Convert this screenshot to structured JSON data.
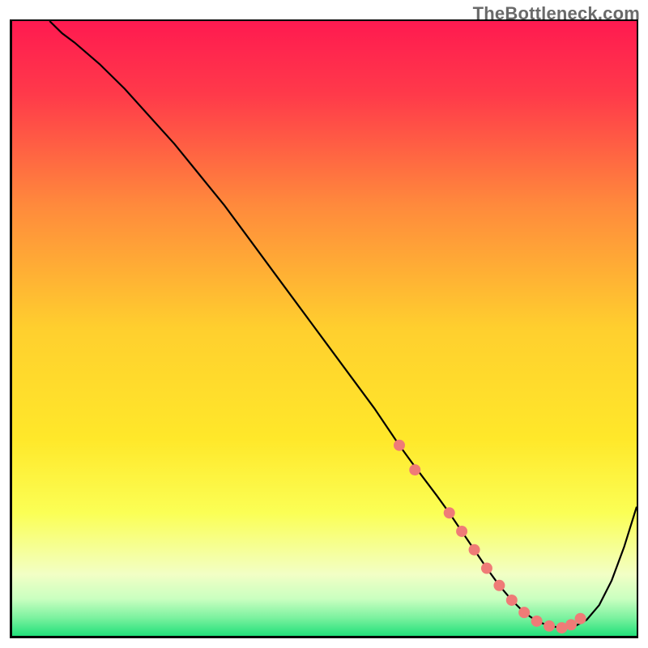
{
  "attribution": "TheBottleneck.com",
  "chart_data": {
    "type": "line",
    "title": "",
    "xlabel": "",
    "ylabel": "",
    "xlim": [
      0,
      100
    ],
    "ylim": [
      0,
      100
    ],
    "background_gradient": {
      "top_color": "#ff1a50",
      "mid_color": "#ffe531",
      "low_band_color": "#f8ffe0",
      "bottom_color": "#22e07a"
    },
    "series": [
      {
        "name": "curve",
        "x": [
          6,
          8,
          10,
          14,
          18,
          22,
          26,
          30,
          34,
          38,
          42,
          46,
          50,
          54,
          58,
          62,
          64,
          66,
          68,
          70,
          72,
          74,
          76,
          78,
          80,
          82,
          84,
          86,
          88,
          90,
          92,
          94,
          96,
          98,
          100
        ],
        "y": [
          100,
          98,
          96.5,
          93,
          89,
          84.5,
          80,
          75,
          70,
          64.5,
          59,
          53.5,
          48,
          42.5,
          37,
          31,
          28.2,
          25.5,
          22.8,
          20,
          17,
          14,
          11,
          8.2,
          5.8,
          3.8,
          2.4,
          1.6,
          1.3,
          1.5,
          2.6,
          5,
          9,
          14.5,
          21
        ]
      }
    ],
    "markers": {
      "name": "highlighted-points",
      "color": "#ef7b77",
      "x": [
        62,
        64.5,
        70,
        72,
        74,
        76,
        78,
        80,
        82,
        84,
        86,
        88,
        89.5,
        91
      ],
      "y": [
        31,
        27,
        20,
        17,
        14,
        11,
        8.2,
        5.8,
        3.8,
        2.4,
        1.6,
        1.3,
        1.8,
        2.8
      ]
    }
  }
}
